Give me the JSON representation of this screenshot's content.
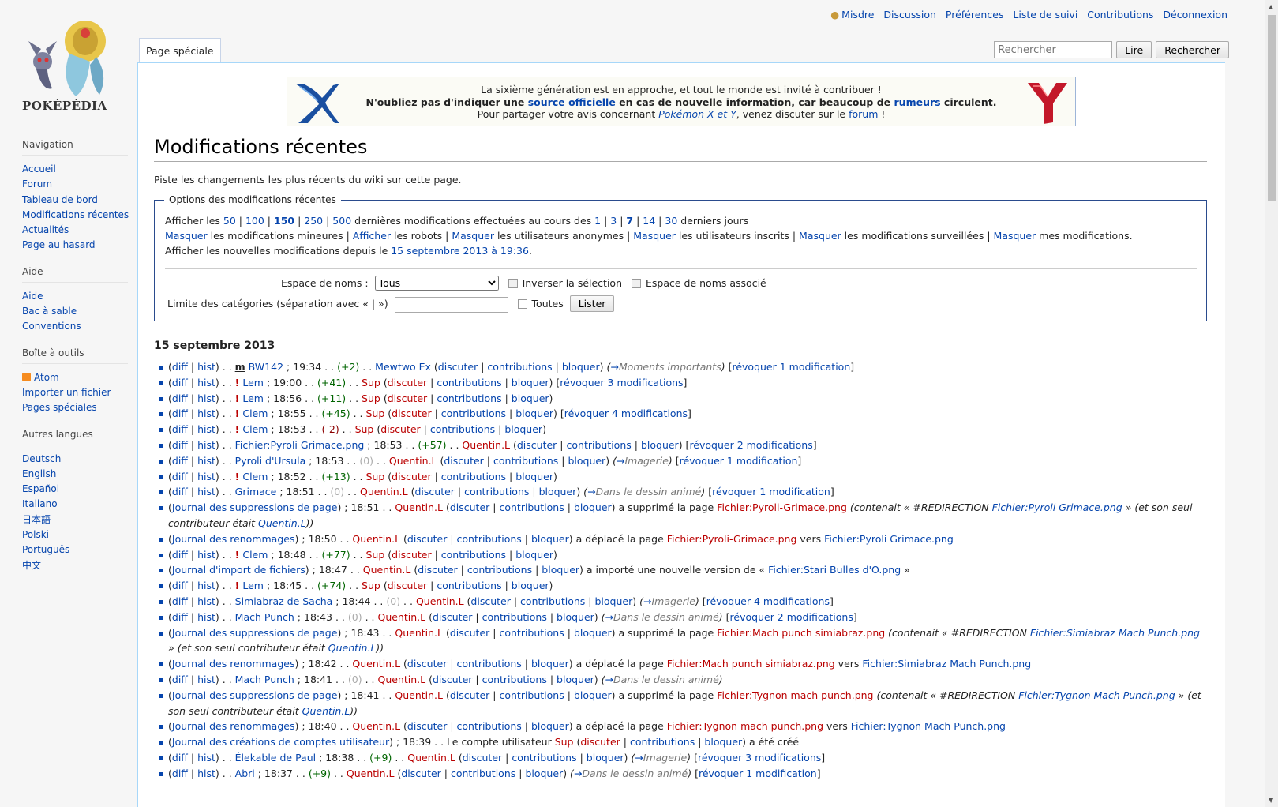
{
  "logo_text": "POKÉPÉDIA",
  "personal": [
    "Misdre",
    "Discussion",
    "Préférences",
    "Liste de suivi",
    "Contributions",
    "Déconnexion"
  ],
  "tab": "Page spéciale",
  "search": {
    "placeholder": "Rechercher",
    "go": "Lire",
    "search": "Rechercher"
  },
  "sidebar": [
    {
      "title": "Navigation",
      "items": [
        "Accueil",
        "Forum",
        "Tableau de bord",
        "Modifications récentes",
        "Actualités",
        "Page au hasard"
      ]
    },
    {
      "title": "Aide",
      "items": [
        "Aide",
        "Bac à sable",
        "Conventions"
      ]
    },
    {
      "title": "Boîte à outils",
      "items": [
        "Atom",
        "Importer un fichier",
        "Pages spéciales"
      ]
    },
    {
      "title": "Autres langues",
      "items": [
        "Deutsch",
        "English",
        "Español",
        "Italiano",
        "日本語",
        "Polski",
        "Português",
        "中文"
      ]
    }
  ],
  "banner": {
    "line1": "La sixième génération est en approche, et tout le monde est invité à contribuer !",
    "line2a": "N'oubliez pas d'indiquer une ",
    "line2b": "source officielle",
    "line2c": " en cas de nouvelle information, car beaucoup de ",
    "line2d": "rumeurs",
    "line2e": " circulent.",
    "line3a": "Pour partager votre avis concernant ",
    "line3b": "Pokémon X et Y",
    "line3c": ", venez discuter sur le ",
    "line3d": "forum",
    "line3e": " !"
  },
  "title": "Modifications récentes",
  "subtitle": "Piste les changements les plus récents du wiki sur cette page.",
  "options": {
    "legend": "Options des modifications récentes",
    "line1": "Afficher les <a>50</a> | <a>100</a> | <a><b>150</b></a> | <a>250</a> | <a>500</a> dernières modifications effectuées au cours des <a>1</a> | <a>3</a> | <a><b>7</b></a> | <a>14</a> | <a>30</a> derniers jours",
    "line2": "<a>Masquer</a> les modifications mineures | <a>Afficher</a> les robots | <a>Masquer</a> les utilisateurs anonymes | <a>Masquer</a> les utilisateurs inscrits | <a>Masquer</a> les modifications surveillées | <a>Masquer</a> mes modifications.",
    "line3": "Afficher les nouvelles modifications depuis le <a>15 septembre 2013 à 19:36</a>.",
    "ns_label": "Espace de noms :",
    "ns_value": "Tous",
    "invert": "Inverser la sélection",
    "assoc": "Espace de noms associé",
    "cat_label": "Limite des catégories (séparation avec « | »)",
    "all": "Toutes",
    "list": "Lister"
  },
  "day": "15 septembre 2013",
  "changes": [
    "(<a>diff</a> | <a>hist</a>) . . <b><u>m</u></b> <a>BW142</a> ; 19:34 . . <span class=pos>(+2)</span> . . <a>Mewtwo Ex</a> (<a>discuter</a> | <a>contributions</a> | <a>bloquer</a>) <span class=it>(<a>→</a><span class=grey>Moments importants</span>)</span> [<a>révoquer 1 modification</a>]",
    "(<a>diff</a> | <a>hist</a>) . . <b class=red>!</b> <a>Lem</a> ; 19:00 . . <span class=pos>(+41)</span> . . <span class=red>Sup</span> (<a class=red>discuter</a> | <a>contributions</a> | <a>bloquer</a>) [<a>révoquer 3 modifications</a>]",
    "(<a>diff</a> | <a>hist</a>) . . <b class=red>!</b> <a>Lem</a> ; 18:56 . . <span class=pos>(+11)</span> . . <span class=red>Sup</span> (<a class=red>discuter</a> | <a>contributions</a> | <a>bloquer</a>)",
    "(<a>diff</a> | <a>hist</a>) . . <b class=red>!</b> <a>Clem</a> ; 18:55 . . <span class=pos>(+45)</span> . . <span class=red>Sup</span> (<a class=red>discuter</a> | <a>contributions</a> | <a>bloquer</a>) [<a>révoquer 4 modifications</a>]",
    "(<a>diff</a> | <a>hist</a>) . . <b class=red>!</b> <a>Clem</a> ; 18:53 . . <span class=neg>(-2)</span> . . <span class=red>Sup</span> (<a class=red>discuter</a> | <a>contributions</a> | <a>bloquer</a>)",
    "(<a>diff</a> | <a>hist</a>) . . <a>Fichier:Pyroli Grimace.png</a> ; 18:53 . . <span class=pos>(+57)</span> . . <span class=red>Quentin.L</span> (<a>discuter</a> | <a>contributions</a> | <a>bloquer</a>) [<a>révoquer 2 modifications</a>]",
    "(<a>diff</a> | <a>hist</a>) . . <a>Pyroli d'Ursula</a> ; 18:53 . . <span class=zero>(0)</span> . . <span class=red>Quentin.L</span> (<a>discuter</a> | <a>contributions</a> | <a>bloquer</a>) <span class=it>(<a>→</a><span class=grey>Imagerie</span>)</span> [<a>révoquer 1 modification</a>]",
    "(<a>diff</a> | <a>hist</a>) . . <b class=red>!</b> <a>Clem</a> ; 18:52 . . <span class=pos>(+13)</span> . . <span class=red>Sup</span> (<a class=red>discuter</a> | <a>contributions</a> | <a>bloquer</a>)",
    "(<a>diff</a> | <a>hist</a>) . . <a>Grimace</a> ; 18:51 . . <span class=zero>(0)</span> . . <span class=red>Quentin.L</span> (<a>discuter</a> | <a>contributions</a> | <a>bloquer</a>) <span class=it>(<a>→</a><span class=grey>Dans le dessin animé</span>)</span> [<a>révoquer 1 modification</a>]",
    "(<a>Journal des suppressions de page</a>) ; 18:51 . . <span class=red>Quentin.L</span> (<a>discuter</a> | <a>contributions</a> | <a>bloquer</a>) a supprimé la page <span class=red>Fichier:Pyroli-Grimace.png</span> <span class=it>(contenait « #REDIRECTION <a>Fichier:Pyroli Grimace.png</a> » (et son seul contributeur était <a>Quentin.L</a>))</span>",
    "(<a>Journal des renommages</a>) ; 18:50 . . <span class=red>Quentin.L</span> (<a>discuter</a> | <a>contributions</a> | <a>bloquer</a>) a déplacé la page <span class=red>Fichier:Pyroli-Grimace.png</span> vers <a>Fichier:Pyroli Grimace.png</a>",
    "(<a>diff</a> | <a>hist</a>) . . <b class=red>!</b> <a>Clem</a> ; 18:48 . . <span class=pos>(+77)</span> . . <span class=red>Sup</span> (<a class=red>discuter</a> | <a>contributions</a> | <a>bloquer</a>)",
    "(<a>Journal d'import de fichiers</a>) ; 18:47 . . <span class=red>Quentin.L</span> (<a>discuter</a> | <a>contributions</a> | <a>bloquer</a>) a importé une nouvelle version de « <a>Fichier:Stari Bulles d'O.png</a> »",
    "(<a>diff</a> | <a>hist</a>) . . <b class=red>!</b> <a>Lem</a> ; 18:45 . . <span class=pos>(+74)</span> . . <span class=red>Sup</span> (<a class=red>discuter</a> | <a>contributions</a> | <a>bloquer</a>)",
    "(<a>diff</a> | <a>hist</a>) . . <a>Simiabraz de Sacha</a> ; 18:44 . . <span class=zero>(0)</span> . . <span class=red>Quentin.L</span> (<a>discuter</a> | <a>contributions</a> | <a>bloquer</a>) <span class=it>(<a>→</a><span class=grey>Imagerie</span>)</span> [<a>révoquer 4 modifications</a>]",
    "(<a>diff</a> | <a>hist</a>) . . <a>Mach Punch</a> ; 18:43 . . <span class=zero>(0)</span> . . <span class=red>Quentin.L</span> (<a>discuter</a> | <a>contributions</a> | <a>bloquer</a>) <span class=it>(<a>→</a><span class=grey>Dans le dessin animé</span>)</span> [<a>révoquer 2 modifications</a>]",
    "(<a>Journal des suppressions de page</a>) ; 18:43 . . <span class=red>Quentin.L</span> (<a>discuter</a> | <a>contributions</a> | <a>bloquer</a>) a supprimé la page <span class=red>Fichier:Mach punch simiabraz.png</span> <span class=it>(contenait « #REDIRECTION <a>Fichier:Simiabraz Mach Punch.png</a> » (et son seul contributeur était <a>Quentin.L</a>))</span>",
    "(<a>Journal des renommages</a>) ; 18:42 . . <span class=red>Quentin.L</span> (<a>discuter</a> | <a>contributions</a> | <a>bloquer</a>) a déplacé la page <span class=red>Fichier:Mach punch simiabraz.png</span> vers <a>Fichier:Simiabraz Mach Punch.png</a>",
    "(<a>diff</a> | <a>hist</a>) . . <a>Mach Punch</a> ; 18:41 . . <span class=zero>(0)</span> . . <span class=red>Quentin.L</span> (<a>discuter</a> | <a>contributions</a> | <a>bloquer</a>) <span class=it>(<a>→</a><span class=grey>Dans le dessin animé</span>)</span>",
    "(<a>Journal des suppressions de page</a>) ; 18:41 . . <span class=red>Quentin.L</span> (<a>discuter</a> | <a>contributions</a> | <a>bloquer</a>) a supprimé la page <span class=red>Fichier:Tygnon mach punch.png</span> <span class=it>(contenait « #REDIRECTION <a>Fichier:Tygnon Mach Punch.png</a> » (et son seul contributeur était <a>Quentin.L</a>))</span>",
    "(<a>Journal des renommages</a>) ; 18:40 . . <span class=red>Quentin.L</span> (<a>discuter</a> | <a>contributions</a> | <a>bloquer</a>) a déplacé la page <span class=red>Fichier:Tygnon mach punch.png</span> vers <a>Fichier:Tygnon Mach Punch.png</a>",
    "(<a>Journal des créations de comptes utilisateur</a>) ; 18:39 . . Le compte utilisateur <span class=red>Sup</span> (<a class=red>discuter</a> | <a>contributions</a> | <a>bloquer</a>) a été créé",
    "(<a>diff</a> | <a>hist</a>) . . <a>Élekable de Paul</a> ; 18:38 . . <span class=pos>(+9)</span> . . <span class=red>Quentin.L</span> (<a>discuter</a> | <a>contributions</a> | <a>bloquer</a>) <span class=it>(<a>→</a><span class=grey>Imagerie</span>)</span> [<a>révoquer 3 modifications</a>]",
    "(<a>diff</a> | <a>hist</a>) . . <a>Abri</a> ; 18:37 . . <span class=pos>(+9)</span> . . <span class=red>Quentin.L</span> (<a>discuter</a> | <a>contributions</a> | <a>bloquer</a>) <span class=it>(<a>→</a><span class=grey>Dans le dessin animé</span>)</span> [<a>révoquer 1 modification</a>]"
  ]
}
